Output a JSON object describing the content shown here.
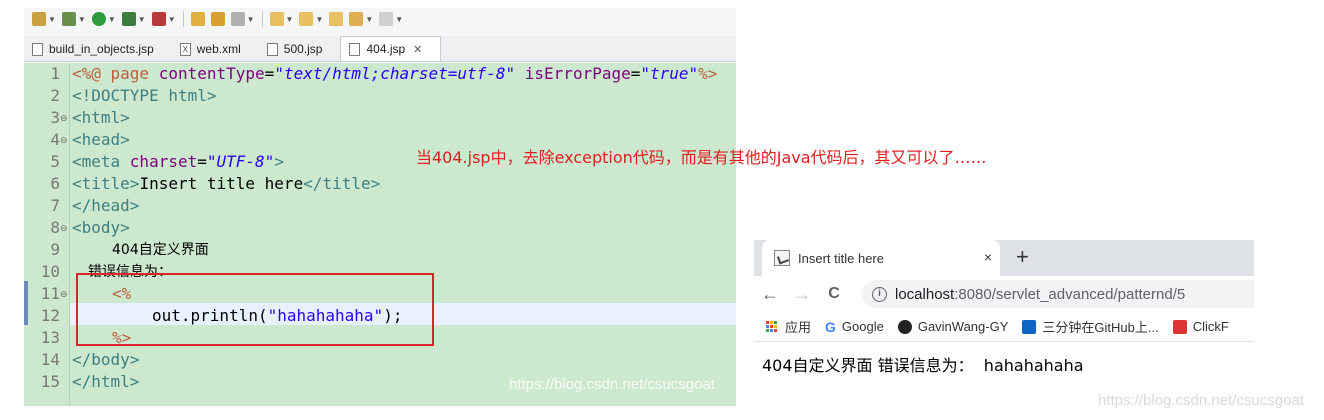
{
  "editor": {
    "tabs": [
      {
        "label": "build_in_objects.jsp",
        "icon": "jsp-file-icon",
        "active": false
      },
      {
        "label": "web.xml",
        "icon": "xml-file-icon",
        "active": false
      },
      {
        "label": "500.jsp",
        "icon": "jsp-file-icon",
        "active": false
      },
      {
        "label": "404.jsp",
        "icon": "jsp-file-icon",
        "active": true
      }
    ],
    "tab_close_glyph": "✕",
    "line_numbers": [
      "1",
      "2",
      "3",
      "4",
      "5",
      "6",
      "7",
      "8",
      "9",
      "10",
      "11",
      "12",
      "13",
      "14",
      "15"
    ],
    "code": {
      "l1_a": "<%@ page ",
      "l1_b": "contentType",
      "l1_c": "=",
      "l1_d": "\"text/html;charset=utf-8\"",
      "l1_e": " isErrorPage",
      "l1_f": "=",
      "l1_g": "\"true\"",
      "l1_h": "%>",
      "l2": "<!DOCTYPE html>",
      "l3": "<html>",
      "l4": "<head>",
      "l5_a": "<meta ",
      "l5_b": "charset",
      "l5_c": "=",
      "l5_d": "\"UTF-8\"",
      "l5_e": ">",
      "l6_a": "<title>",
      "l6_b": "Insert title here",
      "l6_c": "</title>",
      "l7": "</head>",
      "l8": "<body>",
      "l9": "404自定义界面",
      "l10": "错误信息为：",
      "l11": "<%",
      "l12_a": "out.println(",
      "l12_b": "\"hahahahaha\"",
      "l12_c": ");",
      "l13": "%>",
      "l14": "</body>",
      "l15": "</html>"
    },
    "watermark": "https://blog.csdn.net/csucsgoat"
  },
  "annotation": "当404.jsp中，去除exception代码，而是有其他的Java代码后，其又可以了……",
  "browser": {
    "tab_title": "Insert title here",
    "tab_close": "×",
    "new_tab": "+",
    "back": "←",
    "forward": "→",
    "reload": "C",
    "info": "i",
    "url_host": "localhost",
    "url_path": ":8080/servlet_advanced/patternd/5",
    "bookmarks": [
      {
        "label": "应用",
        "icon": "apps-icon"
      },
      {
        "label": "Google",
        "icon": "google-icon"
      },
      {
        "label": "GavinWang-GY",
        "icon": "github-icon"
      },
      {
        "label": "三分钟在GitHub上...",
        "icon": "zhihu-icon"
      },
      {
        "label": "ClickF",
        "icon": "clickfunnels-icon"
      }
    ],
    "content": "404自定义界面 错误信息为：  hahahahaha",
    "watermark": "https://blog.csdn.net/csucsgoat"
  },
  "colors": {
    "editor_bg": "#cce8cf",
    "annotation": "#e02020",
    "highlight_box": "#d9242b"
  }
}
